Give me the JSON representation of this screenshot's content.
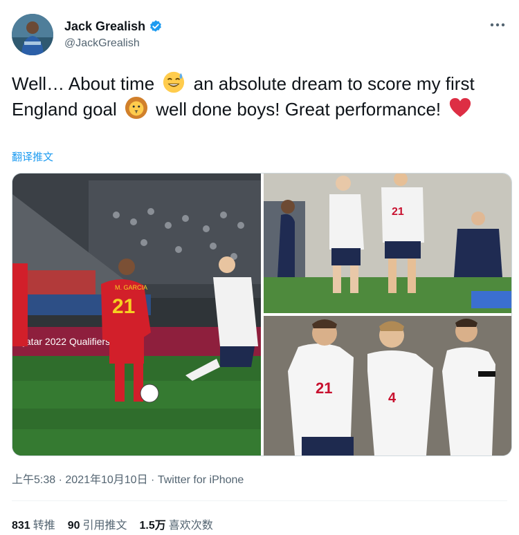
{
  "author": {
    "display_name": "Jack Grealish",
    "handle": "@JackGrealish",
    "verified": true,
    "avatar": "profile-photo"
  },
  "more_icon": "more-horizontal-icon",
  "tweet": {
    "segments": [
      {
        "type": "text",
        "value": "Well… About time "
      },
      {
        "type": "emoji",
        "name": "sweat-smile-emoji"
      },
      {
        "type": "text",
        "value": " an absolute dream to score my first England goal "
      },
      {
        "type": "emoji",
        "name": "lion-emoji"
      },
      {
        "type": "text",
        "value": " well done boys! Great performance! "
      },
      {
        "type": "emoji",
        "name": "red-heart-emoji"
      }
    ],
    "translate_label": "翻译推文"
  },
  "media": {
    "photos": [
      {
        "name": "match-action-photo",
        "shirt_number_1": "21",
        "shirt_name_1": "M. GARCIA",
        "ad_board": "Qatar 2022 Qualifiers"
      },
      {
        "name": "celebration-photo",
        "shirt_number_1": "21"
      },
      {
        "name": "team-photo",
        "shirt_number_1": "21",
        "shirt_number_2": "4"
      }
    ]
  },
  "meta": {
    "time": "上午5:38",
    "date": "2021年10月10日",
    "source": "Twitter for iPhone",
    "separator": "·"
  },
  "stats": {
    "retweets": {
      "count": "831",
      "label": "转推"
    },
    "quotes": {
      "count": "90",
      "label": "引用推文"
    },
    "likes": {
      "count": "1.5万",
      "label": "喜欢次数"
    }
  },
  "colors": {
    "link": "#1d9bf0",
    "secondary_text": "#536471",
    "verified": "#1d9bf0"
  }
}
